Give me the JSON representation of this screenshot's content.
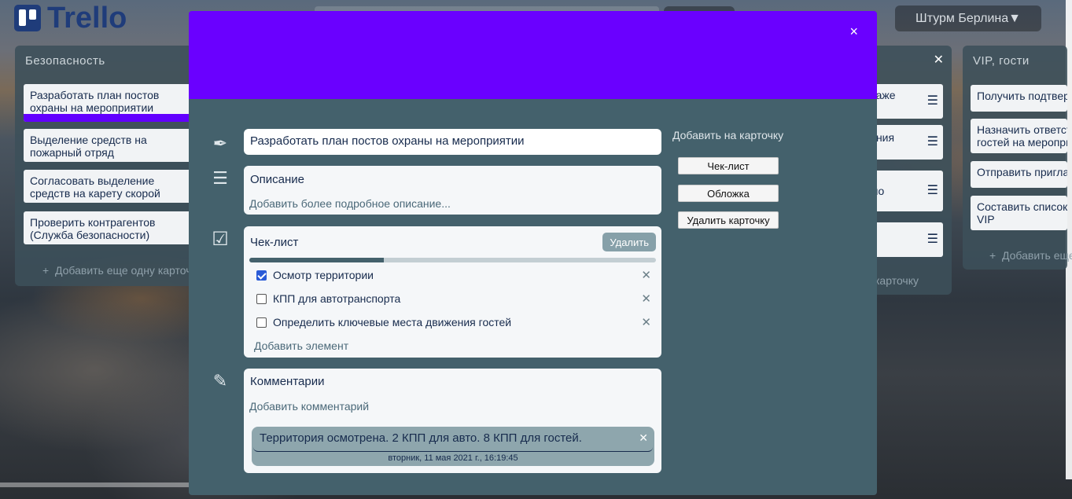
{
  "app": {
    "logo_text": "Trello"
  },
  "header": {
    "board_title": "Штурм Берлина▼"
  },
  "lists": {
    "security": {
      "title": "Безопасность",
      "cards": [
        "Разработать план постов охраны на мероприятии",
        "Выделение средств на пожарный отряд",
        "Согласовать выделение средств на карету скорой помощи",
        "Проверить контрагентов (Служба безопасности)"
      ],
      "add_card": "Добавить еще одну карточку"
    },
    "middle": {
      "cards": [
        "одаже",
        "ления",
        "s по",
        ""
      ],
      "add_card": "карточку"
    },
    "vip": {
      "title": "VIP, гости",
      "cards": [
        "Получить подтверждение",
        "Назначить ответственного гостей на мероприятии",
        "Отправить приглашения",
        "Составить список VIP"
      ],
      "add_card": "Добавить еще"
    }
  },
  "modal": {
    "close_glyph": "×",
    "cover_color": "#6a00ff",
    "title": "Разработать план постов охраны на мероприятии",
    "description": {
      "heading": "Описание",
      "placeholder": "Добавить более подробное описание..."
    },
    "checklist": {
      "heading": "Чек-лист",
      "delete_label": "Удалить",
      "progress": 0.33,
      "items": [
        {
          "label": "Осмотр территории",
          "checked": true
        },
        {
          "label": "КПП для автотранспорта",
          "checked": false
        },
        {
          "label": "Определить ключевые места движения гостей",
          "checked": false
        }
      ],
      "add_item": "Добавить элемент"
    },
    "comments": {
      "heading": "Комментарии",
      "add_link": "Добавить комментарий",
      "items": [
        {
          "text": "Территория осмотрена. 2 КПП для авто. 8 КПП для гостей.",
          "date": "вторник, 11 мая 2021 г., 16:19:45"
        }
      ]
    },
    "sidebar": {
      "heading": "Добавить на карточку",
      "buttons": [
        "Чек-лист",
        "Обложка",
        "Удалить карточку"
      ]
    }
  },
  "colors": {
    "accent": "#6200ff",
    "modal_bg": "#44616c"
  }
}
